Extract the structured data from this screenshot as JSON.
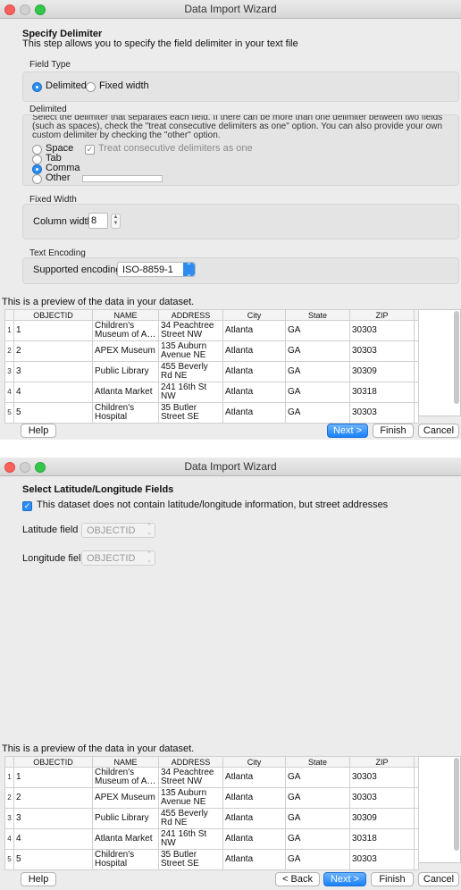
{
  "wizard1": {
    "title": "Data Import Wizard",
    "heading": "Specify Delimiter",
    "subheading": "This step allows you to specify the field delimiter in your text file",
    "field_type": {
      "label": "Field Type",
      "delimited": "Delimited",
      "fixed_width": "Fixed width",
      "selected": "Delimited"
    },
    "delimited": {
      "label": "Delimited",
      "description": "Select the delimiter that separates each field.  If there can be more than one delimiter between two fields (such as spaces), check the \"treat consecutive delimiters as one\" option.  You can also provide your own custom delimiter by checking the \"other\" option.",
      "options": [
        "Space",
        "Tab",
        "Comma",
        "Other"
      ],
      "selected": "Comma",
      "consecutive_label": "Treat consecutive delimiters as one",
      "other_value": ""
    },
    "fixed_width": {
      "label": "Fixed Width",
      "column_width_label": "Column width",
      "column_width_value": "8"
    },
    "encoding": {
      "label": "Text Encoding",
      "supported_label": "Supported encodings",
      "value": "ISO-8859-1"
    },
    "preview_label": "This is a preview of the data in your dataset.",
    "buttons": {
      "help": "Help",
      "next": "Next >",
      "finish": "Finish",
      "cancel": "Cancel"
    }
  },
  "wizard2": {
    "title": "Data Import Wizard",
    "heading": "Select Latitude/Longitude Fields",
    "checkbox_label": "This dataset does not contain latitude/longitude information, but street addresses",
    "checkbox_checked": true,
    "latitude_label": "Latitude field",
    "latitude_value": "OBJECTID",
    "longitude_label": "Longitude field",
    "longitude_value": "OBJECTID",
    "preview_label": "This is a preview of the data in your dataset.",
    "buttons": {
      "help": "Help",
      "back": "< Back",
      "next": "Next >",
      "finish": "Finish",
      "cancel": "Cancel"
    }
  },
  "table": {
    "columns": [
      "OBJECTID",
      "NAME",
      "ADDRESS",
      "City",
      "State",
      "ZIP"
    ],
    "rows": [
      {
        "n": "1",
        "cells": [
          "1",
          "Children's Museum of A…",
          "34 Peachtree Street NW",
          "Atlanta",
          "GA",
          "30303"
        ]
      },
      {
        "n": "2",
        "cells": [
          "2",
          "APEX Museum",
          "135 Auburn Avenue NE",
          "Atlanta",
          "GA",
          "30303"
        ]
      },
      {
        "n": "3",
        "cells": [
          "3",
          "Public Library",
          "455 Beverly Rd NE",
          "Atlanta",
          "GA",
          "30309"
        ]
      },
      {
        "n": "4",
        "cells": [
          "4",
          "Atlanta Market",
          "241 16th St NW",
          "Atlanta",
          "GA",
          "30318"
        ]
      },
      {
        "n": "5",
        "cells": [
          "5",
          "Children's Hospital",
          "35 Butler Street SE",
          "Atlanta",
          "GA",
          "30303"
        ]
      }
    ]
  },
  "colors": {
    "accent": "#2d8cf0",
    "window_bg": "#ececec",
    "group_bg": "#e4e4e4"
  }
}
